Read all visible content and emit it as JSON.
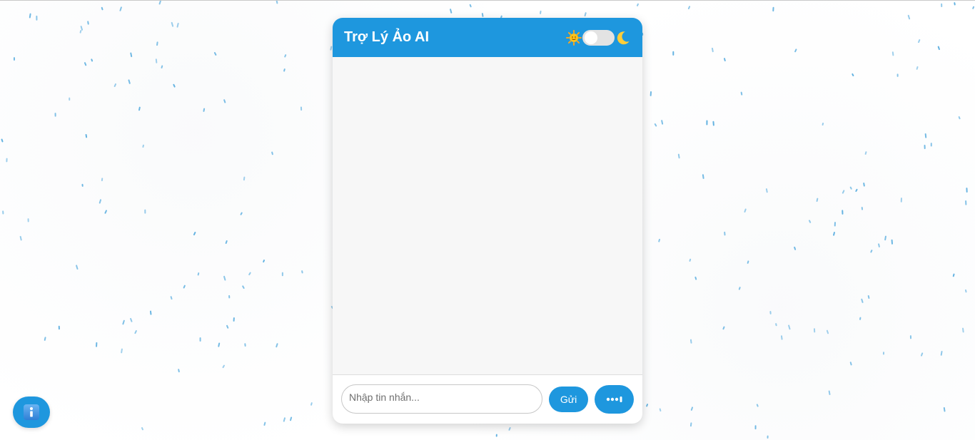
{
  "chat": {
    "title": "Trợ Lý Ảo AI",
    "theme_toggle": {
      "left_icon": "sun-icon",
      "right_icon": "moon-icon",
      "dark_mode": false
    },
    "messages": [],
    "input": {
      "placeholder": "Nhập tin nhắn...",
      "value": ""
    },
    "send_label": "Gửi",
    "voice_icon": "voice-waveform-icon"
  },
  "info_button": {
    "icon": "info-icon"
  },
  "colors": {
    "accent": "#1e97de",
    "messages_bg": "#f7f7f7",
    "particle": "#5aaee0"
  }
}
